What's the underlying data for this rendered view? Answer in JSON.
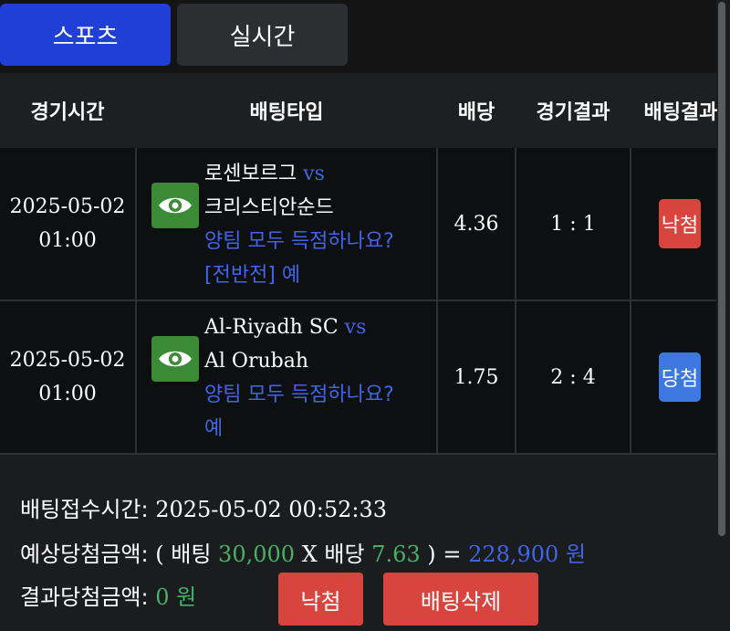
{
  "tabs": [
    {
      "label": "스포츠"
    },
    {
      "label": "실시간"
    }
  ],
  "header": {
    "time": "경기시간",
    "type": "배팅타입",
    "odds": "배당",
    "result": "경기결과",
    "bet_result": "배팅결과"
  },
  "rows": [
    {
      "date": "2025-05-02",
      "time": "01:00",
      "home": "로센보르그",
      "vs": "vs",
      "away": "크리스티안순드",
      "question": "양팀 모두 득점하나요?",
      "pick": "[전반전] 예",
      "odds": "4.36",
      "score": "1 : 1",
      "status": "낙첨",
      "status_color": "#d8453f"
    },
    {
      "date": "2025-05-02",
      "time": "01:00",
      "home": "Al-Riyadh SC",
      "vs": "vs",
      "away": "Al Orubah",
      "question": "양팀 모두 득점하나요?",
      "pick": "예",
      "odds": "1.75",
      "score": "2 : 4",
      "status": "당첨",
      "status_color": "#3d78e0"
    }
  ],
  "summary": {
    "time_label": "배팅접수시간:",
    "time_value": "2025-05-02 00:52:33",
    "expected_label": "예상당첨금액:",
    "open_paren": "(",
    "bet_label": "배팅",
    "bet_amount": "30,000",
    "times": "X",
    "odds_label": "배당",
    "total_odds": "7.63",
    "close_paren": ")",
    "equals": "=",
    "expected_amount": "228,900",
    "won": "원",
    "result_label": "결과당첨금액:",
    "result_amount": "0",
    "result_won": "원"
  },
  "buttons": {
    "status": "낙첨",
    "delete": "배팅삭제"
  },
  "icons": {
    "bet_detail": "eye-icon"
  },
  "colors": {
    "tab_active": "#1f3fd6",
    "lose": "#d8453f",
    "win": "#3d78e0",
    "link": "#3f66e8",
    "amount_green": "#47b267"
  }
}
